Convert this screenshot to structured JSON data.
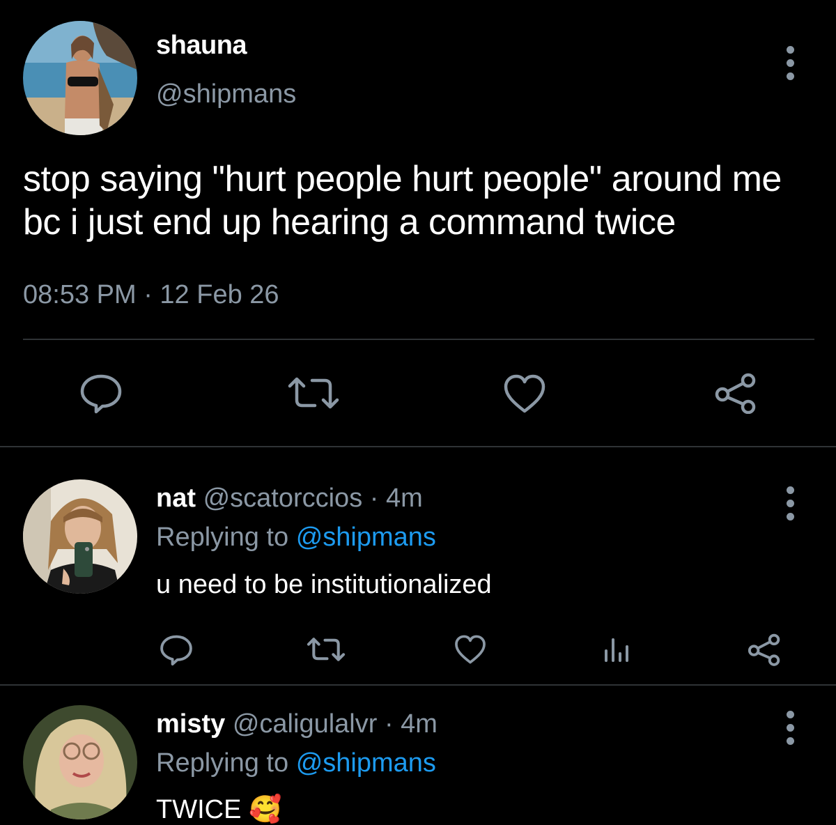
{
  "main_tweet": {
    "display_name": "shauna",
    "handle": "@shipmans",
    "text_line1": "stop saying \"hurt people hurt people\" around me",
    "text_line2": "bc i just end up hearing a command twice",
    "timestamp": "08:53 PM · 12 Feb 26",
    "actions": [
      "reply-icon",
      "retweet-icon",
      "like-icon",
      "share-icon"
    ]
  },
  "replies": [
    {
      "display_name": "nat",
      "handle": "@scatorccios",
      "separator": "·",
      "time": "4m",
      "replying_prefix": "Replying to",
      "replying_to": "@shipmans",
      "text": "u need to be institutionalized",
      "actions": [
        "reply-icon",
        "retweet-icon",
        "like-icon",
        "analytics-icon",
        "share-icon"
      ]
    },
    {
      "display_name": "misty",
      "handle": "@caligulalvr",
      "separator": "·",
      "time": "4m",
      "replying_prefix": "Replying to",
      "replying_to": "@shipmans",
      "text": "TWICE",
      "emoji": "🥰"
    }
  ],
  "colors": {
    "background": "#000000",
    "text": "#ffffff",
    "muted": "#8b98a5",
    "link": "#1d9bf0",
    "divider": "#2f3336"
  }
}
